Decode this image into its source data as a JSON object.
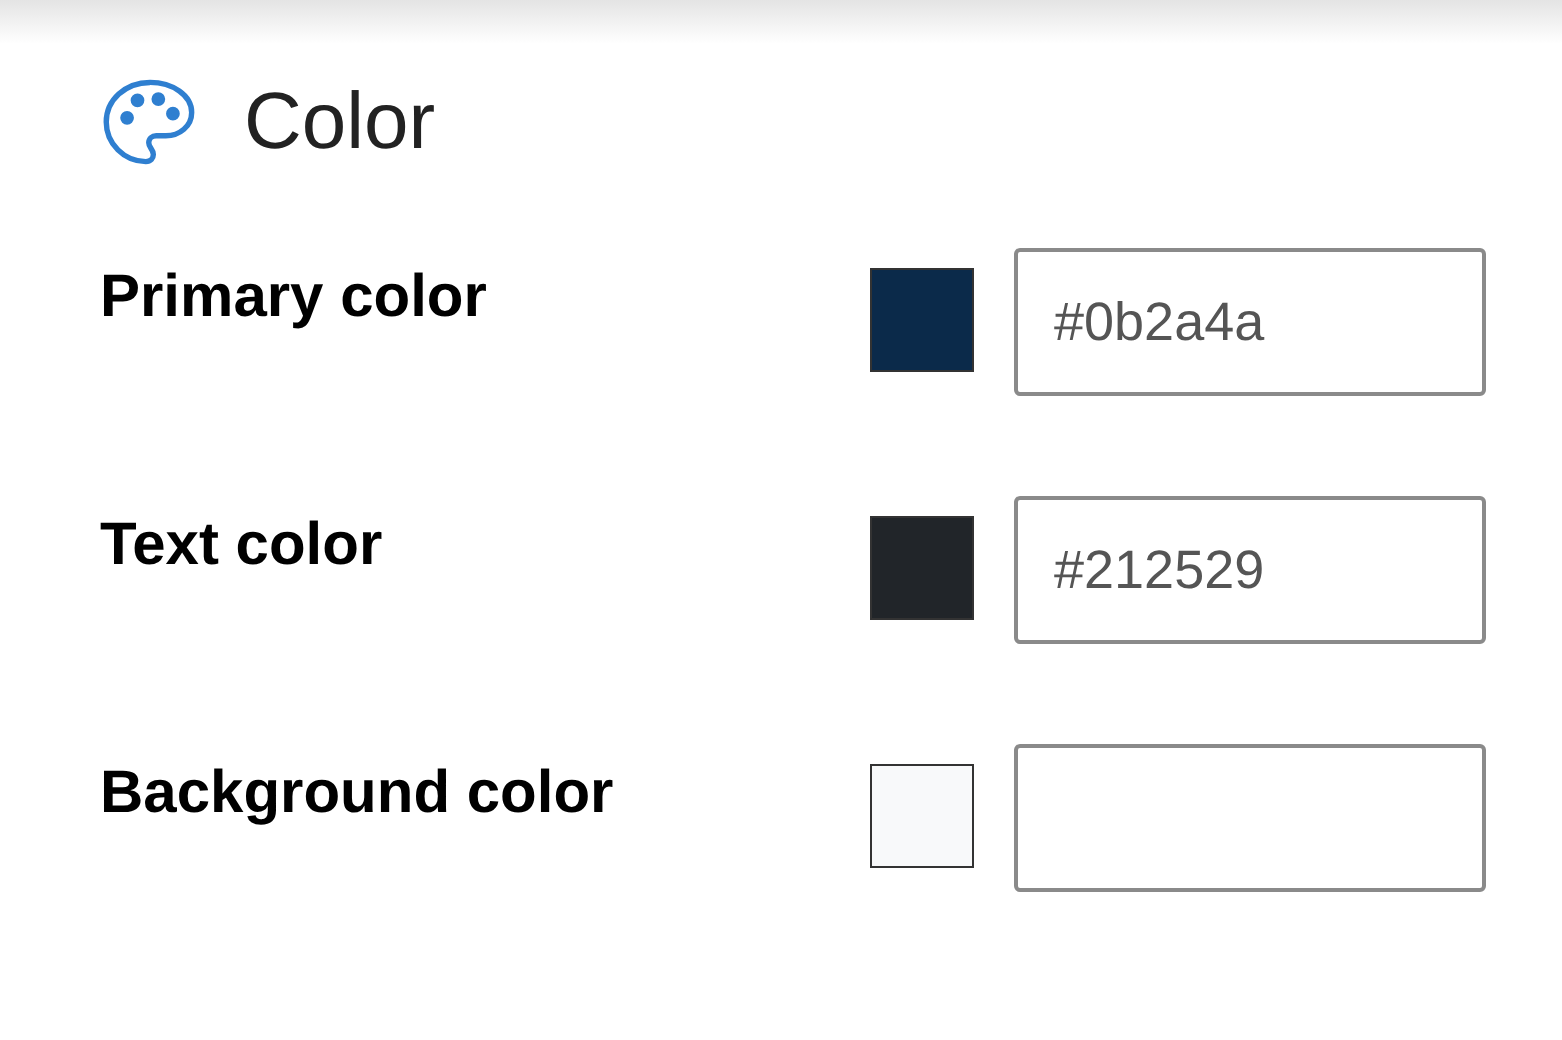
{
  "section": {
    "title": "Color"
  },
  "fields": [
    {
      "label": "Primary color",
      "color": "#0b2a4a",
      "value": "#0b2a4a"
    },
    {
      "label": "Text color",
      "color": "#212529",
      "value": "#212529"
    },
    {
      "label": "Background color",
      "color": "#f8f9fa"
    }
  ]
}
